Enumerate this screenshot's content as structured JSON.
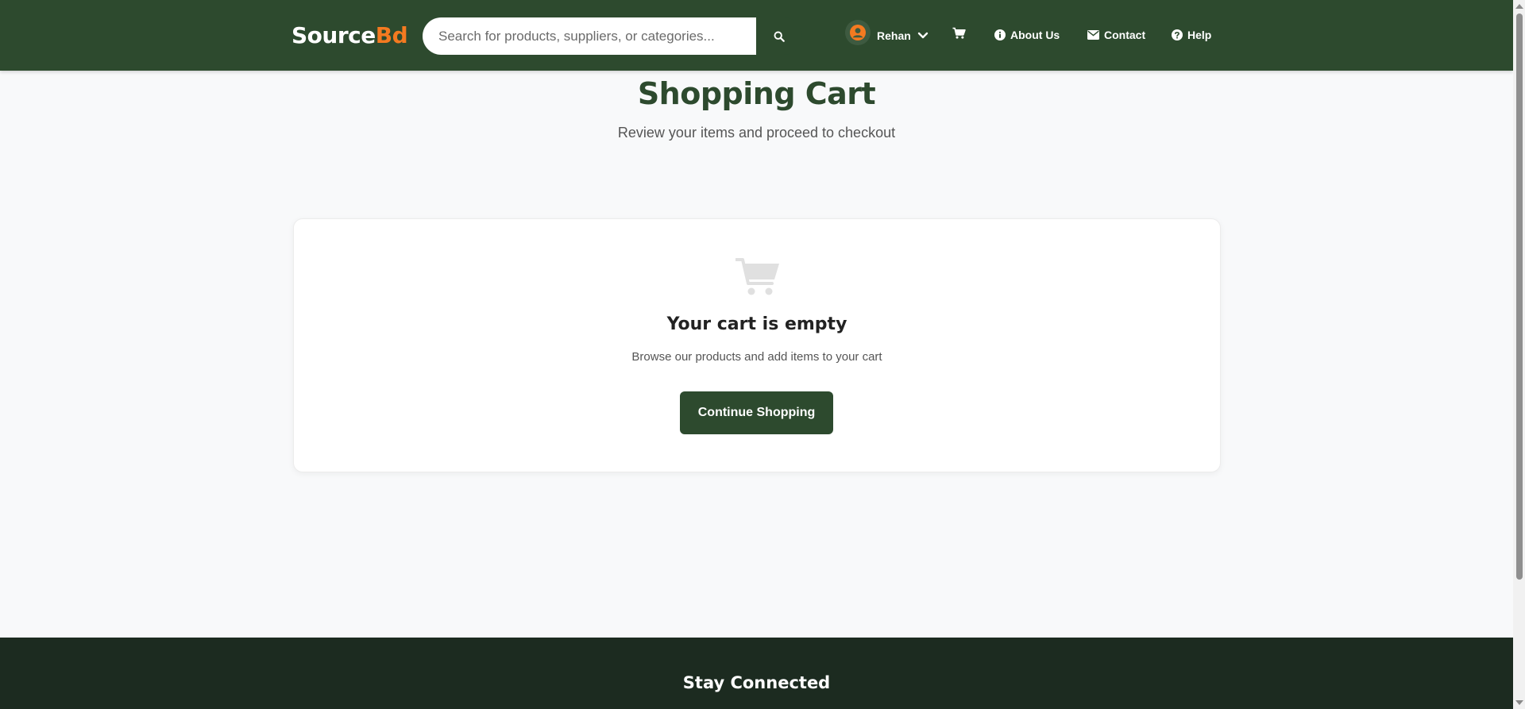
{
  "header": {
    "logo_part1": "Source",
    "logo_part2": "Bd",
    "search_placeholder": "Search for products, suppliers, or categories...",
    "search_value": "",
    "user_name": "Rehan",
    "nav": {
      "about_label": "About Us",
      "contact_label": "Contact",
      "help_label": "Help"
    }
  },
  "main": {
    "title": "Shopping Cart",
    "subtitle": "Review your items and proceed to checkout",
    "empty_state": {
      "icon": "shopping-cart-icon",
      "title": "Your cart is empty",
      "text": "Browse our products and add items to your cart",
      "button_label": "Continue Shopping"
    }
  },
  "footer": {
    "title": "Stay Connected"
  },
  "colors": {
    "primary": "#2d4a2e",
    "accent": "#f47a20",
    "footer_bg": "#1c2b20",
    "page_bg": "#f8f9fa"
  }
}
